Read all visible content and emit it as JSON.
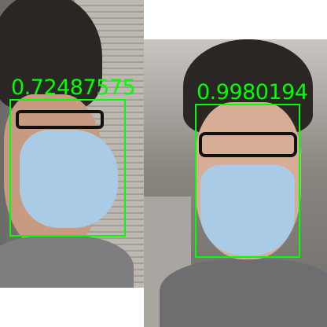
{
  "detections": [
    {
      "label": "0.72487575",
      "class": "mask"
    },
    {
      "label": "0.9980194",
      "class": "mask"
    }
  ],
  "colors": {
    "box": "#00ff00",
    "mask": "#aacbe6",
    "hair": "#2a2624",
    "skin": "#c99a82",
    "shirt": "#7d7d80"
  }
}
